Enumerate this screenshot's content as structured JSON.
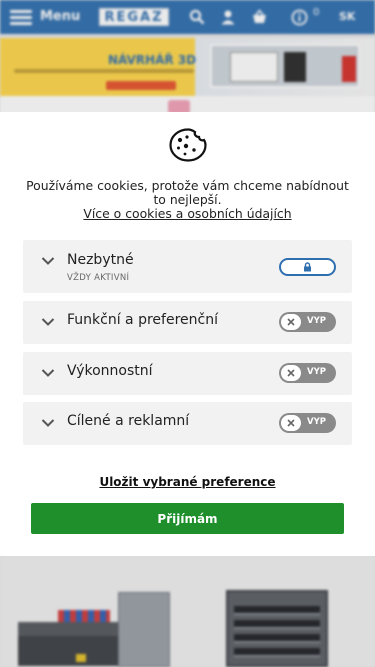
{
  "header": {
    "menu_label": "Menu",
    "logo_text": "REGAZ",
    "notification_count": "0",
    "language": "SK"
  },
  "banner": {
    "title": "NÁVRHÁŘ 3D"
  },
  "cookie_modal": {
    "intro_text": "Používáme cookies, protože vám chceme nabídnout to nejlepší.",
    "more_link": "Více o cookies a osobních údajích",
    "preferences": [
      {
        "title": "Nezbytné",
        "subtitle": "VŽDY AKTIVNÍ",
        "state": "always_on"
      },
      {
        "title": "Funkční a preferenční",
        "toggle_label": "VYP",
        "enabled": false
      },
      {
        "title": "Výkonnostní",
        "toggle_label": "VYP",
        "enabled": false
      },
      {
        "title": "Cílené a reklamní",
        "toggle_label": "VYP",
        "enabled": false
      }
    ],
    "save_label": "Uložit vybrané preference",
    "accept_label": "Přijímám"
  },
  "colors": {
    "header_blue": "#2f6fb0",
    "accept_green": "#1e8f2b",
    "toggle_off_gray": "#8a8a8a",
    "panel_gray": "#f2f2f2"
  }
}
